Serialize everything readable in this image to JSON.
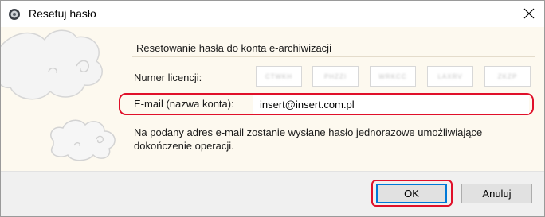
{
  "window": {
    "title": "Resetuj hasło",
    "close_icon": "close-icon"
  },
  "dialog": {
    "section_title": "Resetowanie hasła do konta e-archiwizacji",
    "licence_label": "Numer licencji:",
    "licence_parts": [
      "CTWKH",
      "PHZZI",
      "WRKCC",
      "LAXRV",
      "ZKZP"
    ],
    "email_label": "E-mail (nazwa konta):",
    "email_value": "insert@insert.com.pl",
    "info_line1": "Na podany adres e-mail zostanie wysłane hasło jednorazowe umożliwiające",
    "info_line2": "dokończenie operacji."
  },
  "footer": {
    "ok_label": "OK",
    "cancel_label": "Anuluj"
  },
  "colors": {
    "highlight": "#e0102a",
    "content_bg": "#fdf9ef",
    "footer_bg": "#f0f0f0",
    "default_button_border": "#0078d7"
  }
}
